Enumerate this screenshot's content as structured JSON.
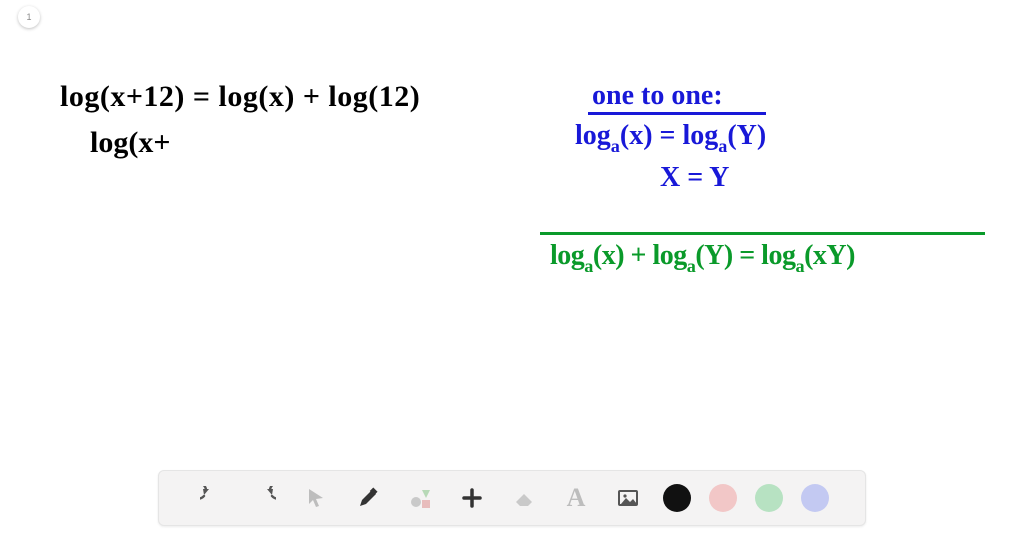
{
  "page_badge": "1",
  "handwriting": {
    "eq1": "log(x+12) = log(x) + log(12)",
    "eq2": "log(x+",
    "blue_header": "one to one:",
    "blue_eq1_html": "log<span class='sub'>a</span>(x) = log<span class='sub'>a</span>(Y)",
    "blue_eq2": "X = Y",
    "green_eq_html": "log<span class='sub'>a</span>(x) + log<span class='sub'>a</span>(Y) = log<span class='sub'>a</span>(xY)"
  },
  "toolbar": {
    "undo": "undo",
    "redo": "redo",
    "pointer": "pointer",
    "pen": "pen",
    "shapes": "shapes",
    "plus": "add",
    "eraser": "eraser",
    "text_label": "A",
    "image": "image",
    "colors": {
      "black": "#111111",
      "red": "#f2c7c7",
      "green": "#b7e2c2",
      "blue": "#c3c9f2"
    }
  }
}
